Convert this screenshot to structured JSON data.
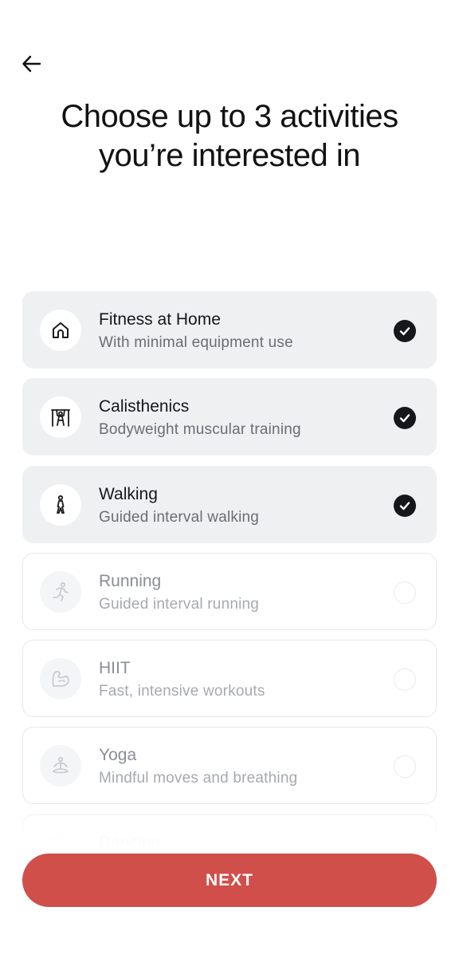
{
  "header": {
    "back_icon": "arrow-left-icon",
    "title": "Choose up to 3 activities you’re interested in"
  },
  "activities": [
    {
      "title": "Fitness at Home",
      "subtitle": "With minimal equipment use",
      "icon": "home-icon",
      "selected": true
    },
    {
      "title": "Calisthenics",
      "subtitle": "Bodyweight muscular training",
      "icon": "pullup-bar-icon",
      "selected": true
    },
    {
      "title": "Walking",
      "subtitle": "Guided interval walking",
      "icon": "walking-person-icon",
      "selected": true
    },
    {
      "title": "Running",
      "subtitle": "Guided interval running",
      "icon": "running-person-icon",
      "selected": false
    },
    {
      "title": "HIIT",
      "subtitle": "Fast, intensive workouts",
      "icon": "flexed-arm-icon",
      "selected": false
    },
    {
      "title": "Yoga",
      "subtitle": "Mindful moves and breathing",
      "icon": "meditation-icon",
      "selected": false
    },
    {
      "title": "Dancing",
      "subtitle": "",
      "icon": "dance-icon",
      "selected": false
    }
  ],
  "footer": {
    "next_label": "NEXT"
  },
  "colors": {
    "accent": "#d04f4a",
    "selected_card_bg": "#eff0f2",
    "check_fill": "#15171b"
  }
}
